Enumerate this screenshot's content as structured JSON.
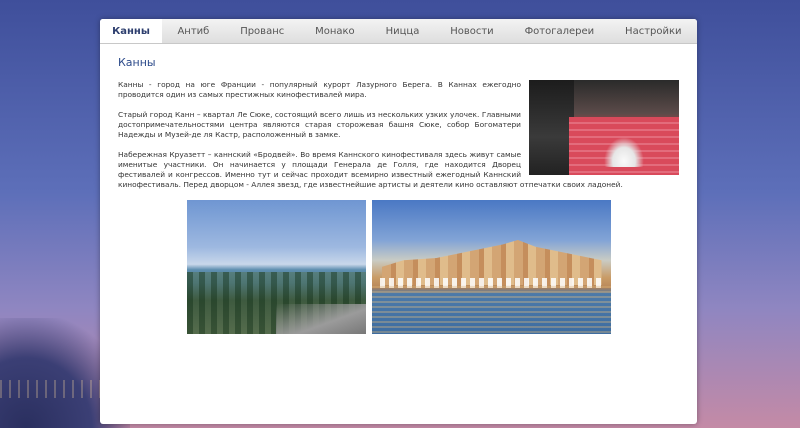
{
  "nav": {
    "items": [
      {
        "label": "Канны",
        "active": true
      },
      {
        "label": "Антиб",
        "active": false
      },
      {
        "label": "Прованс",
        "active": false
      },
      {
        "label": "Монако",
        "active": false
      },
      {
        "label": "Ницца",
        "active": false
      },
      {
        "label": "Новости",
        "active": false
      },
      {
        "label": "Фотогалереи",
        "active": false
      },
      {
        "label": "Настройки",
        "active": false
      }
    ]
  },
  "article": {
    "title": "Канны",
    "paragraphs": [
      "Канны - город на юге Франции - популярный курорт Лазурного Берега. В Каннах ежегодно проводится один из самых престижных кинофестивалей мира.",
      "Старый город Канн – квартал Ле Сюке, состоящий всего лишь из нескольких узких улочек. Главными достопримечательностями центра являются старая сторожевая башня Сюке, собор Богоматери Надежды и Музей-де ля Кастр, расположенный в замке.",
      "Набережная Круазетт – каннский «Бродвей». Во время Каннского кинофестиваля здесь живут самые именитые участники. Он начинается у площади Генерала де Голля, где находится Дворец фестивалей и конгрессов. Именно тут и сейчас проходит всемирно известный ежегодный Каннский кинофестиваль. Перед дворцом - Аллея звезд, где известнейшие артисты и деятели кино оставляют отпечатки своих ладоней."
    ]
  },
  "colors": {
    "title": "#2c4a8a",
    "active_tab": "#2d3e6e",
    "text": "#333333"
  }
}
